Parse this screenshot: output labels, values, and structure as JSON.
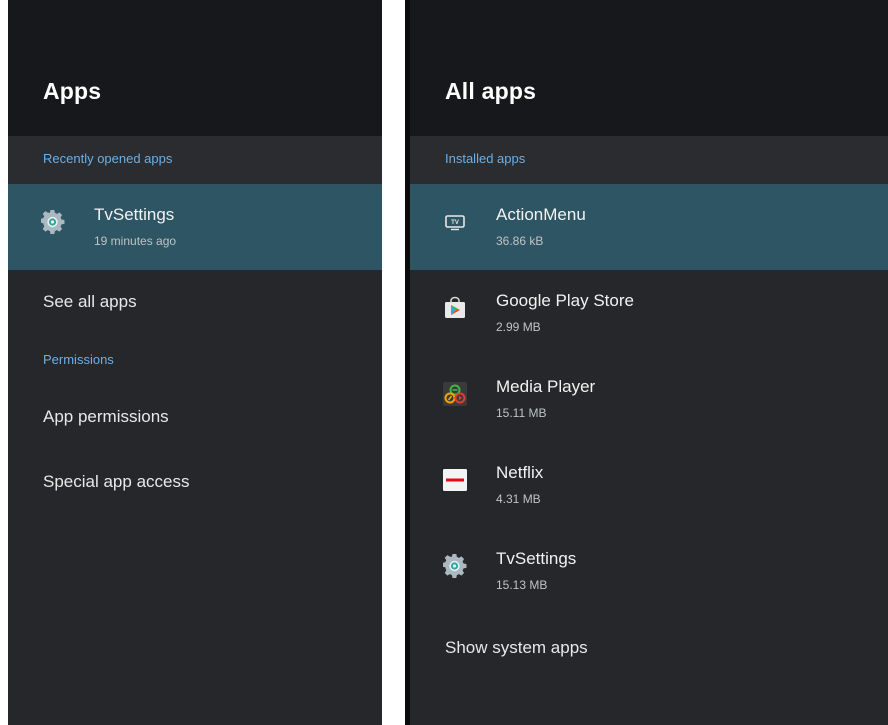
{
  "left": {
    "title": "Apps",
    "section_recent": "Recently opened apps",
    "recent_app": {
      "name": "TvSettings",
      "sub": "19 minutes ago",
      "icon": "gear-icon"
    },
    "see_all": "See all apps",
    "section_permissions": "Permissions",
    "app_permissions": "App permissions",
    "special_access": "Special app access"
  },
  "right": {
    "title": "All apps",
    "section_installed": "Installed apps",
    "apps": [
      {
        "name": "ActionMenu",
        "size": "36.86 kB",
        "icon": "tv-icon"
      },
      {
        "name": "Google Play Store",
        "size": "2.99 MB",
        "icon": "play-store-icon"
      },
      {
        "name": "Media Player",
        "size": "15.11 MB",
        "icon": "media-player-icon"
      },
      {
        "name": "Netflix",
        "size": "4.31 MB",
        "icon": "netflix-icon"
      },
      {
        "name": "TvSettings",
        "size": "15.13 MB",
        "icon": "gear-icon"
      }
    ],
    "show_system": "Show system apps"
  },
  "colors": {
    "panel_bg": "#26272b",
    "header_bg": "#17181b",
    "selected_row": "#2e5563",
    "section_text": "#6ab0e8"
  }
}
